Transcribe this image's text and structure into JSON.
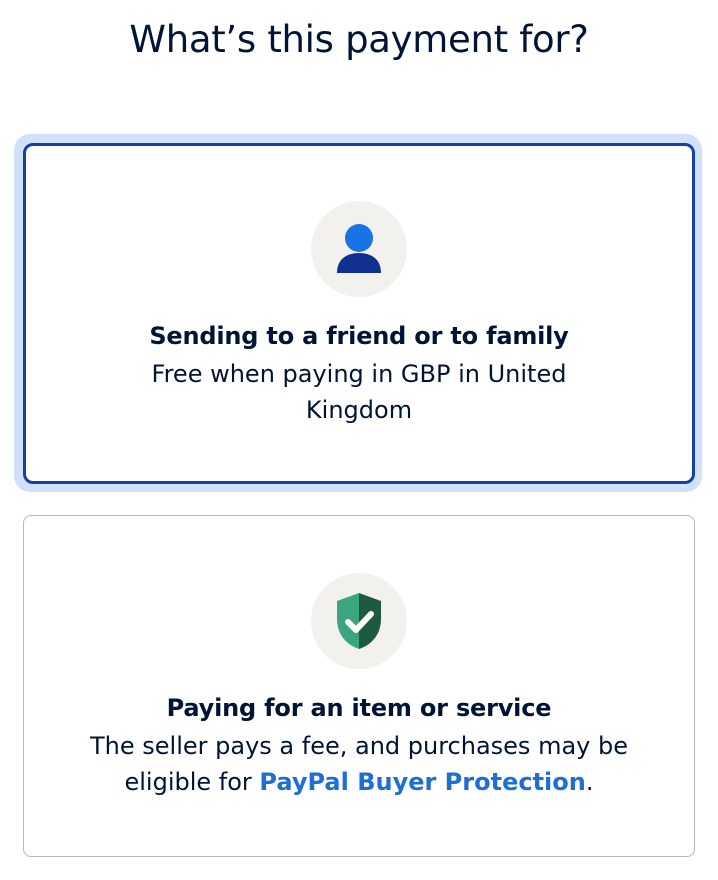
{
  "page": {
    "title": "What’s this payment for?"
  },
  "options": [
    {
      "title": "Sending to a friend or to family",
      "description": "Free when paying in GBP in United Kingdom",
      "icon": "person-icon",
      "selected": true
    },
    {
      "title": "Paying for an item or service",
      "description_prefix": "The seller pays a fee, and purchases may be eligible for ",
      "link_text": "PayPal Buyer Protection",
      "description_suffix": ".",
      "icon": "shield-check-icon",
      "selected": false
    }
  ],
  "colors": {
    "selected_border": "#1540a8",
    "focus_ring": "#d1e1fb",
    "link": "#1f6ed4",
    "icon_bg": "#f3f1ed",
    "person_head": "#1874e5",
    "person_body": "#12308f",
    "shield_light": "#3aa57f",
    "shield_dark": "#1d5a3f"
  }
}
